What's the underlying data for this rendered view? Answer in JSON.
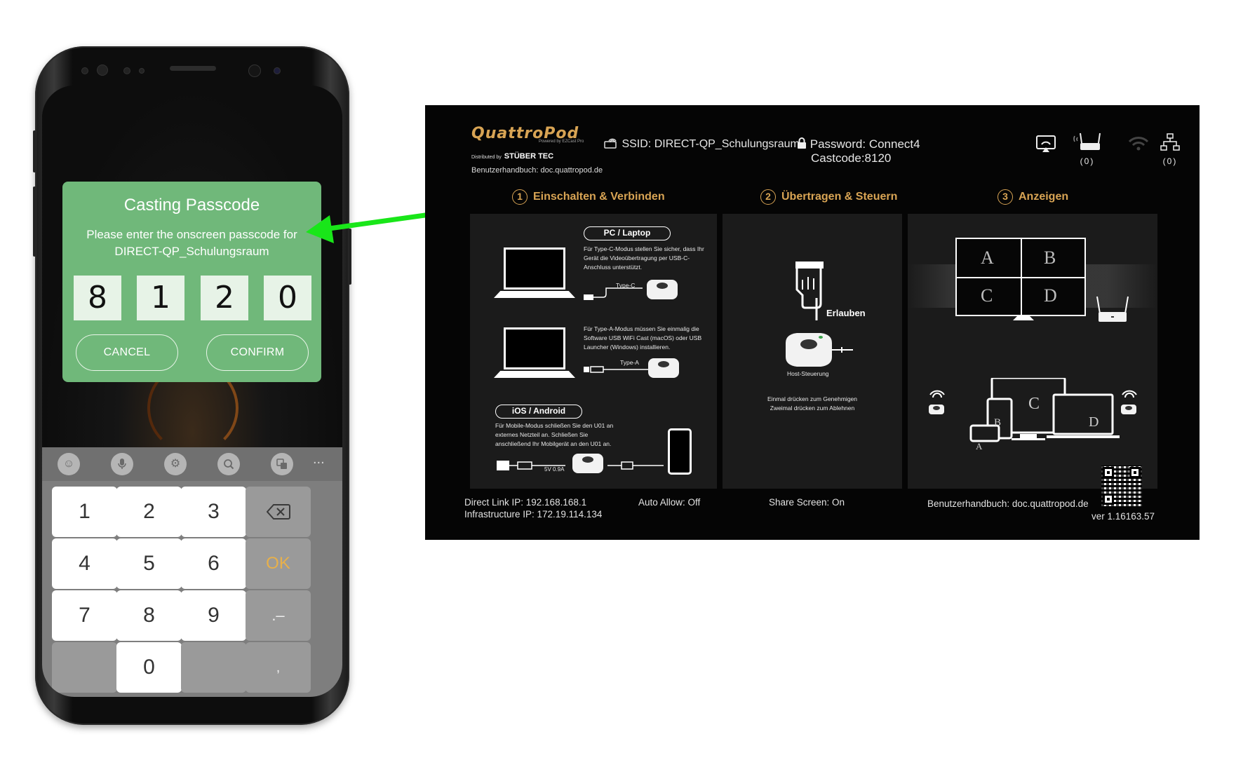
{
  "phone": {
    "dialog": {
      "title": "Casting Passcode",
      "message": "Please enter the onscreen passcode for DIRECT-QP_Schulungsraum",
      "digits": [
        "8",
        "1",
        "2",
        "0"
      ],
      "cancel_label": "CANCEL",
      "confirm_label": "CONFIRM",
      "accent_color": "#70b87a"
    },
    "keyboard": {
      "toolbar_icons": [
        "emoji-icon",
        "microphone-icon",
        "settings-icon",
        "search-icon",
        "translate-icon"
      ],
      "more_label": "...",
      "keys": [
        "1",
        "2",
        "3",
        "4",
        "5",
        "6",
        "7",
        "8",
        "9",
        "0"
      ],
      "ok_label": "OK",
      "dot_dash_label": ".–",
      "comma_label": ",",
      "backspace_icon": "backspace-icon"
    }
  },
  "arrow": {
    "color": "#19e619"
  },
  "tv": {
    "logo": "QuattroPod",
    "logo_sub": "Powered by EZCast Pro",
    "distributed_by": "Distributed by",
    "distributor": "STÜBER TEC",
    "manual_top": "Benutzerhandbuch: doc.quattropod.de",
    "ssid": "SSID: DIRECT-QP_Schulungsraum",
    "password": "Password: Connect4",
    "castcode": "Castcode:8120",
    "router_count": "(0)",
    "lan_count": "(0)",
    "steps": [
      {
        "num": "1",
        "label": "Einschalten & Verbinden"
      },
      {
        "num": "2",
        "label": "Übertragen & Steuern"
      },
      {
        "num": "3",
        "label": "Anzeigen"
      }
    ],
    "panel1": {
      "pc_label": "PC / Laptop",
      "typec_text": "Für Type-C-Modus stellen Sie sicher, dass Ihr Gerät die Videoübertragung per USB-C-Anschluss unterstützt.",
      "typec_label": "Type-C",
      "typea_text": "Für Type-A-Modus müssen Sie einmalig die Software USB WiFi Cast (macOS) oder USB Launcher (Windows) installieren.",
      "typea_label": "Type-A",
      "mobile_label": "iOS / Android",
      "mobile_text": "Für Mobile-Modus schließen Sie den U01 an externes Netzteil an. Schließen Sie anschließend Ihr Mobilgerät an den U01 an.",
      "power_label": "5V 0.9A"
    },
    "panel2": {
      "allow_label": "Erlauben",
      "host_label": "Host-Steuerung",
      "press_text": "Einmal drücken zum Genehmigen\nZweimal drücken zum Ablehnen"
    },
    "panel3": {
      "quadrants": [
        "A",
        "B",
        "C",
        "D"
      ],
      "device_letters": [
        "A",
        "B",
        "C",
        "D"
      ]
    },
    "footer": {
      "direct_ip": "Direct Link IP: 192.168.168.1",
      "infra_ip": "Infrastructure IP: 172.19.114.134",
      "auto_allow": "Auto Allow: Off",
      "share_screen": "Share Screen: On",
      "manual": "Benutzerhandbuch: doc.quattropod.de",
      "version": "ver 1.16163.57"
    },
    "gold_color": "#d8a454"
  }
}
